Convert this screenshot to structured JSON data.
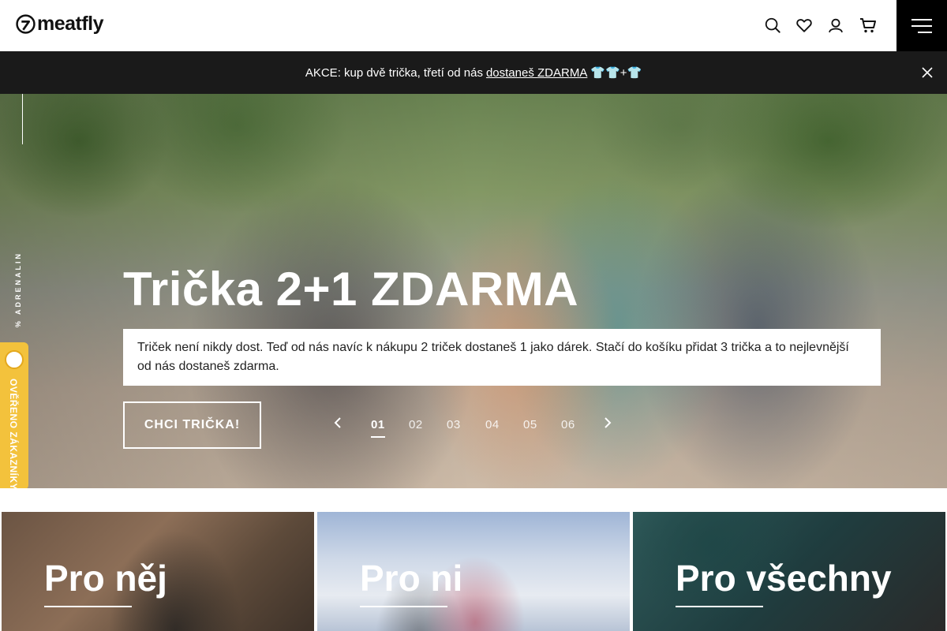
{
  "header": {
    "logo_text": "meatfly",
    "icons": [
      "search-icon",
      "heart-icon",
      "user-icon",
      "cart-icon",
      "menu-icon"
    ]
  },
  "promo": {
    "text": "AKCE: kup dvě trička, třetí od nás",
    "link": "dostaneš ZDARMA",
    "suffix": "👕👕+👕"
  },
  "hero": {
    "side_text": "% ADRENALIN",
    "verified_label": "OVĚŘENO ZÁKAZNÍKY",
    "title": "Trička 2+1 ZDARMA",
    "description": "Triček není nikdy dost. Teď od nás navíc k nákupu 2 triček dostaneš 1 jako dárek. Stačí do košíku přidat 3 trička a to nejlevnější od nás dostaneš zdarma.",
    "cta": "CHCI TRIČKA!",
    "pager": [
      "01",
      "02",
      "03",
      "04",
      "05",
      "06"
    ],
    "active_slide": "01"
  },
  "categories": [
    {
      "title": "Pro něj"
    },
    {
      "title": "Pro ni"
    },
    {
      "title": "Pro všechny"
    }
  ],
  "colors": {
    "promo_bg": "#1a1a1a",
    "verified_badge": "#f3c23c",
    "menu_bg": "#000000"
  }
}
